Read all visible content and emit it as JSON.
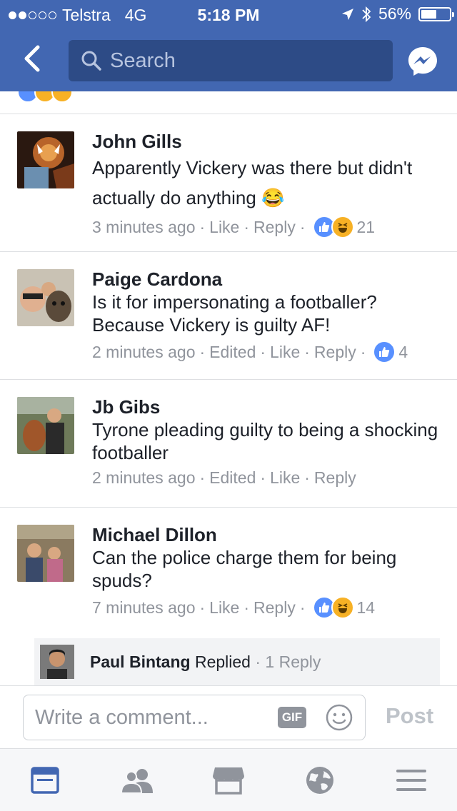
{
  "status_bar": {
    "carrier": "Telstra",
    "network": "4G",
    "time": "5:18 PM",
    "battery": "56%",
    "signal_bars_filled": 2,
    "signal_bars_total": 5
  },
  "header": {
    "search_placeholder": "Search",
    "icons": [
      "back-chevron-icon",
      "search-icon",
      "messenger-icon"
    ]
  },
  "colors": {
    "brand_blue": "#4267b2",
    "like_blue": "#5890ff",
    "haha_yellow": "#f7b125",
    "muted_text": "#90949c"
  },
  "comments": [
    {
      "author": "John Gills",
      "text": "Apparently Vickery was there but didn't actually do anything",
      "emoji": "😂",
      "time": "3 minutes ago",
      "edited": "",
      "like": "Like",
      "reply": "Reply",
      "reactions": [
        "like",
        "haha"
      ],
      "reaction_count": "21"
    },
    {
      "author": "Paige Cardona",
      "text": "Is it for impersonating a footballer? Because Vickery is guilty AF!",
      "time": "2 minutes ago",
      "edited": "Edited",
      "like": "Like",
      "reply": "Reply",
      "reactions": [
        "like"
      ],
      "reaction_count": "4"
    },
    {
      "author": "Jb Gibs",
      "text": "Tyrone pleading guilty to being a shocking footballer",
      "time": "2 minutes ago",
      "edited": "Edited",
      "like": "Like",
      "reply": "Reply",
      "reactions": [],
      "reaction_count": ""
    },
    {
      "author": "Michael Dillon",
      "text": "Can the police charge them for being spuds?",
      "time": "7 minutes ago",
      "edited": "",
      "like": "Like",
      "reply": "Reply",
      "reactions": [
        "like",
        "haha"
      ],
      "reaction_count": "14"
    }
  ],
  "reply_summary": {
    "name": "Paul Bintang",
    "action": "Replied",
    "count": "1 Reply"
  },
  "composer": {
    "placeholder": "Write a comment...",
    "gif_label": "GIF",
    "post_label": "Post"
  },
  "tabbar": {
    "tabs": [
      "news-feed",
      "friends",
      "marketplace",
      "notifications",
      "menu"
    ],
    "active": "news-feed"
  }
}
